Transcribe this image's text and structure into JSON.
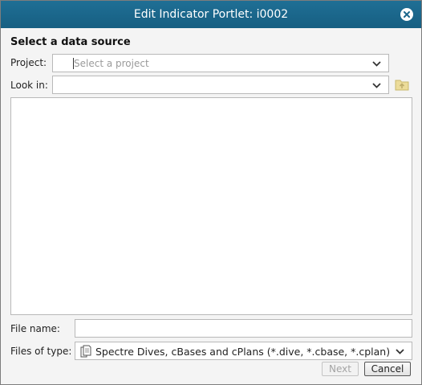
{
  "dialog": {
    "title": "Edit Indicator Portlet: i0002",
    "close_icon": "close-icon"
  },
  "source": {
    "heading": "Select a data source",
    "project_label": "Project:",
    "project_placeholder": "Select a project",
    "project_value": "",
    "lookin_label": "Look in:",
    "lookin_value": "",
    "up_folder_icon": "folder-up-icon"
  },
  "file_list": {
    "items": []
  },
  "filename": {
    "label": "File name:",
    "value": ""
  },
  "filetype": {
    "label": "Files of type:",
    "selected": "Spectre Dives, cBases and cPlans (*.dive, *.cbase, *.cplan)",
    "icon": "documents-icon"
  },
  "buttons": {
    "next": "Next",
    "cancel": "Cancel"
  },
  "colors": {
    "titlebar": "#1a668b",
    "background": "#f4f4f4"
  }
}
